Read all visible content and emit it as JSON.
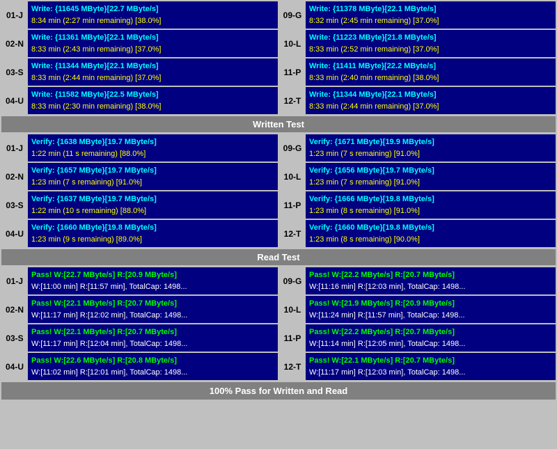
{
  "sections": {
    "write_test": {
      "label": "Written Test",
      "rows_left": [
        {
          "id": "01-J",
          "line1": "Write: {11645 MByte}[22.7 MByte/s]",
          "line2": "8:34 min (2:27 min remaining)  [38.0%]"
        },
        {
          "id": "02-N",
          "line1": "Write: {11361 MByte}[22.1 MByte/s]",
          "line2": "8:33 min (2:43 min remaining)  [37.0%]"
        },
        {
          "id": "03-S",
          "line1": "Write: {11344 MByte}[22.1 MByte/s]",
          "line2": "8:33 min (2:44 min remaining)  [37.0%]"
        },
        {
          "id": "04-U",
          "line1": "Write: {11582 MByte}[22.5 MByte/s]",
          "line2": "8:33 min (2:30 min remaining)  [38.0%]"
        }
      ],
      "rows_right": [
        {
          "id": "09-G",
          "line1": "Write: {11378 MByte}[22.1 MByte/s]",
          "line2": "8:32 min (2:45 min remaining)  [37.0%]"
        },
        {
          "id": "10-L",
          "line1": "Write: {11223 MByte}[21.8 MByte/s]",
          "line2": "8:33 min (2:52 min remaining)  [37.0%]"
        },
        {
          "id": "11-P",
          "line1": "Write: {11411 MByte}[22.2 MByte/s]",
          "line2": "8:33 min (2:40 min remaining)  [38.0%]"
        },
        {
          "id": "12-T",
          "line1": "Write: {11344 MByte}[22.1 MByte/s]",
          "line2": "8:33 min (2:44 min remaining)  [37.0%]"
        }
      ]
    },
    "verify_section": {
      "label": "Written Test",
      "rows_left": [
        {
          "id": "01-J",
          "line1": "Verify: {1638 MByte}[19.7 MByte/s]",
          "line2": "1:22 min (11 s remaining)   [88.0%]"
        },
        {
          "id": "02-N",
          "line1": "Verify: {1657 MByte}[19.7 MByte/s]",
          "line2": "1:23 min (7 s remaining)   [91.0%]"
        },
        {
          "id": "03-S",
          "line1": "Verify: {1637 MByte}[19.7 MByte/s]",
          "line2": "1:22 min (10 s remaining)   [88.0%]"
        },
        {
          "id": "04-U",
          "line1": "Verify: {1660 MByte}[19.8 MByte/s]",
          "line2": "1:23 min (9 s remaining)   [89.0%]"
        }
      ],
      "rows_right": [
        {
          "id": "09-G",
          "line1": "Verify: {1671 MByte}[19.9 MByte/s]",
          "line2": "1:23 min (7 s remaining)   [91.0%]"
        },
        {
          "id": "10-L",
          "line1": "Verify: {1656 MByte}[19.7 MByte/s]",
          "line2": "1:23 min (7 s remaining)   [91.0%]"
        },
        {
          "id": "11-P",
          "line1": "Verify: {1666 MByte}[19.8 MByte/s]",
          "line2": "1:23 min (8 s remaining)   [91.0%]"
        },
        {
          "id": "12-T",
          "line1": "Verify: {1660 MByte}[19.8 MByte/s]",
          "line2": "1:23 min (8 s remaining)   [90.0%]"
        }
      ]
    },
    "read_test": {
      "label": "Read Test",
      "rows_left": [
        {
          "id": "01-J",
          "line1": "Pass! W:[22.7 MByte/s] R:[20.9 MByte/s]",
          "line2": "W:[11:00 min] R:[11:57 min], TotalCap: 1498..."
        },
        {
          "id": "02-N",
          "line1": "Pass! W:[22.1 MByte/s] R:[20.7 MByte/s]",
          "line2": "W:[11:17 min] R:[12:02 min], TotalCap: 1498..."
        },
        {
          "id": "03-S",
          "line1": "Pass! W:[22.1 MByte/s] R:[20.7 MByte/s]",
          "line2": "W:[11:17 min] R:[12:04 min], TotalCap: 1498..."
        },
        {
          "id": "04-U",
          "line1": "Pass! W:[22.6 MByte/s] R:[20.8 MByte/s]",
          "line2": "W:[11:02 min] R:[12:01 min], TotalCap: 1498..."
        }
      ],
      "rows_right": [
        {
          "id": "09-G",
          "line1": "Pass! W:[22.2 MByte/s] R:[20.7 MByte/s]",
          "line2": "W:[11:16 min] R:[12:03 min], TotalCap: 1498..."
        },
        {
          "id": "10-L",
          "line1": "Pass! W:[21.9 MByte/s] R:[20.9 MByte/s]",
          "line2": "W:[11:24 min] R:[11:57 min], TotalCap: 1498..."
        },
        {
          "id": "11-P",
          "line1": "Pass! W:[22.2 MByte/s] R:[20.7 MByte/s]",
          "line2": "W:[11:14 min] R:[12:05 min], TotalCap: 1498..."
        },
        {
          "id": "12-T",
          "line1": "Pass! W:[22.1 MByte/s] R:[20.7 MByte/s]",
          "line2": "W:[11:17 min] R:[12:03 min], TotalCap: 1498..."
        }
      ]
    }
  },
  "labels": {
    "written_test": "Written Test",
    "read_test": "Read Test",
    "footer": "100% Pass for Written and Read"
  }
}
